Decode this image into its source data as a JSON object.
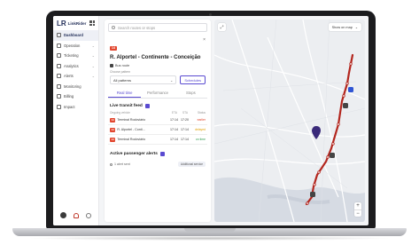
{
  "app": {
    "logo_mark": "LR",
    "logo_text": "LinkRider"
  },
  "sidebar": {
    "items": [
      {
        "label": "Dashboard",
        "active": true,
        "icon": "star-icon"
      },
      {
        "label": "Operation",
        "chevron": true,
        "icon": "bus-icon"
      },
      {
        "label": "Ticketing",
        "chevron": true,
        "icon": "ticket-icon"
      },
      {
        "label": "Analytics",
        "chevron": true,
        "icon": "chart-icon"
      },
      {
        "label": "Alerts",
        "chevron": true,
        "icon": "alert-icon"
      },
      {
        "label": "Monitoring",
        "chevron": false,
        "icon": "pulse-icon"
      },
      {
        "label": "Billing",
        "chevron": false,
        "icon": "billing-icon"
      },
      {
        "label": "Impact",
        "chevron": false,
        "icon": "leaf-icon"
      }
    ]
  },
  "panel": {
    "search_placeholder": "Search routes or stops",
    "stop_tag": "14",
    "stop_title": "R. Alportel - Continente - Conceição",
    "bus_label": "Bus route",
    "pattern_label": "Choose pattern",
    "pattern_value": "All patterns",
    "schedules_label": "Schedules",
    "tabs": [
      "Real time",
      "Performance",
      "Stops"
    ],
    "live_title": "Live transit feed",
    "table_headers": [
      "Ongoing vehicle",
      "ETA",
      "STA",
      "Status"
    ],
    "rows": [
      {
        "route": "14",
        "dest": "Terminal Rodoviário",
        "eta": "17:14",
        "sta": "17:20",
        "status": "earlier",
        "color": "#e2472f"
      },
      {
        "route": "14",
        "dest": "R. Alportel - Conti…",
        "eta": "17:14",
        "sta": "17:14",
        "status": "delayed",
        "color": "#e0a100"
      },
      {
        "route": "14",
        "dest": "Terminal Rodoviário",
        "eta": "17:14",
        "sta": "17:14",
        "status": "on time",
        "color": "#2e9b4e"
      }
    ],
    "alerts_title": "Active passenger alerts",
    "alert_text": "1 alert sent",
    "alert_pill": "Additional service"
  },
  "map": {
    "dropdown_label": "Show on map",
    "zoom_in": "+",
    "zoom_out": "−",
    "route_color": "#b3261e"
  }
}
